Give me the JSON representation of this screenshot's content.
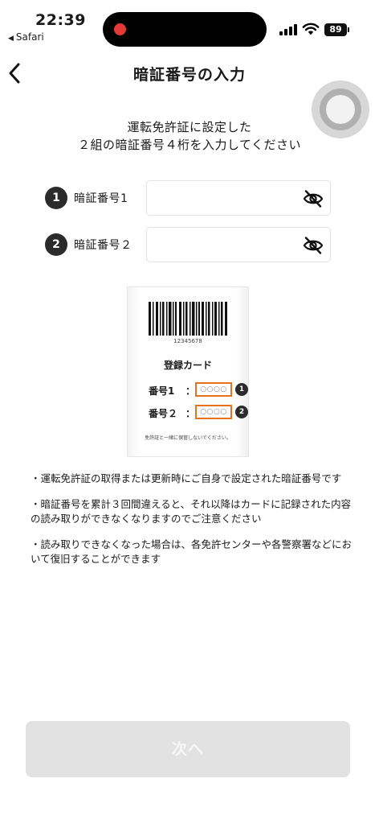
{
  "status_bar": {
    "time": "22:39",
    "back_app": "Safari",
    "battery": "89",
    "recording_color": "#e53935"
  },
  "header": {
    "title": "暗証番号の入力",
    "back_icon": "chevron-left-icon"
  },
  "instruction": {
    "line1": "運転免許証に設定した",
    "line2": "２組の暗証番号４桁を入力してください"
  },
  "pin_fields": [
    {
      "number": "1",
      "label": "暗証番号1",
      "value": "",
      "icon": "eye-off-icon"
    },
    {
      "number": "2",
      "label": "暗証番号２",
      "value": "",
      "icon": "eye-off-icon"
    }
  ],
  "card_illustration": {
    "barcode_number": "12345678",
    "title": "登録カード",
    "rows": [
      {
        "label": "番号1",
        "colon": "：",
        "digits": "○○○○",
        "badge": "1"
      },
      {
        "label": "番号２",
        "colon": "：",
        "digits": "○○○○",
        "badge": "2"
      }
    ],
    "note": "免許証と一緒に保管しないでください。",
    "highlight_color": "#e8731e"
  },
  "notes": [
    "・運転免許証の取得または更新時にご自身で設定された暗証番号です",
    "・暗証番号を累計３回間違えると、それ以降はカードに記録された内容の読み取りができなくなりますのでご注意ください",
    "・読み取りできなくなった場合は、各免許センターや各警察署などにおいて復旧することができます"
  ],
  "next_button": {
    "label": "次へ",
    "state": "disabled"
  }
}
